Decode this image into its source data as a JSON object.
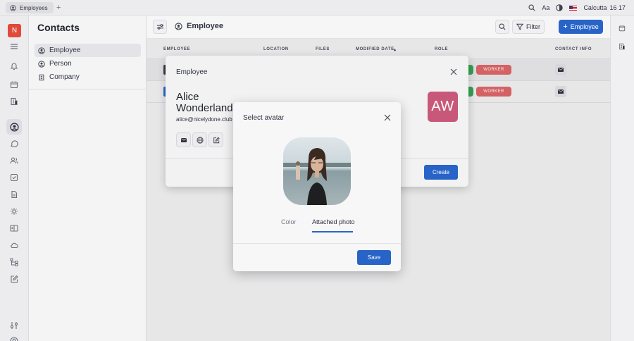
{
  "tabs": [
    {
      "label": "Employees",
      "icon": "person-circle-icon"
    }
  ],
  "topbar": {
    "location": "Calcutta",
    "time": "16 17",
    "font_label": "Aa"
  },
  "app": {
    "logo_letter": "N"
  },
  "navigator": {
    "title": "Contacts",
    "items": [
      {
        "label": "Employee",
        "icon": "person-circle-icon",
        "active": true
      },
      {
        "label": "Person",
        "icon": "person-circle-icon"
      },
      {
        "label": "Company",
        "icon": "building-icon"
      }
    ]
  },
  "main": {
    "title": "Employee",
    "filter_label": "Filter",
    "new_label": "Employee",
    "columns": [
      "EMPLOYEE",
      "LOCATION",
      "FILES",
      "MODIFIED DATE",
      "ROLE",
      "CONTACT INFO"
    ],
    "rows": [
      {
        "role": "WORKER"
      },
      {
        "role": "WORKER"
      }
    ]
  },
  "panel": {
    "title": "Employee",
    "first_name": "Alice",
    "last_name": "Wonderland",
    "email": "alice@nicelydone.club",
    "initials": "AW",
    "create_label": "Create"
  },
  "modal": {
    "title": "Select avatar",
    "tabs": [
      "Color",
      "Attached photo"
    ],
    "active_tab": "Attached photo",
    "save_label": "Save"
  },
  "colors": {
    "accent": "#2864c8",
    "role_badge": "#e2686b",
    "avatar_bg": "#c8587a",
    "logo_bg": "#e04a3a"
  }
}
